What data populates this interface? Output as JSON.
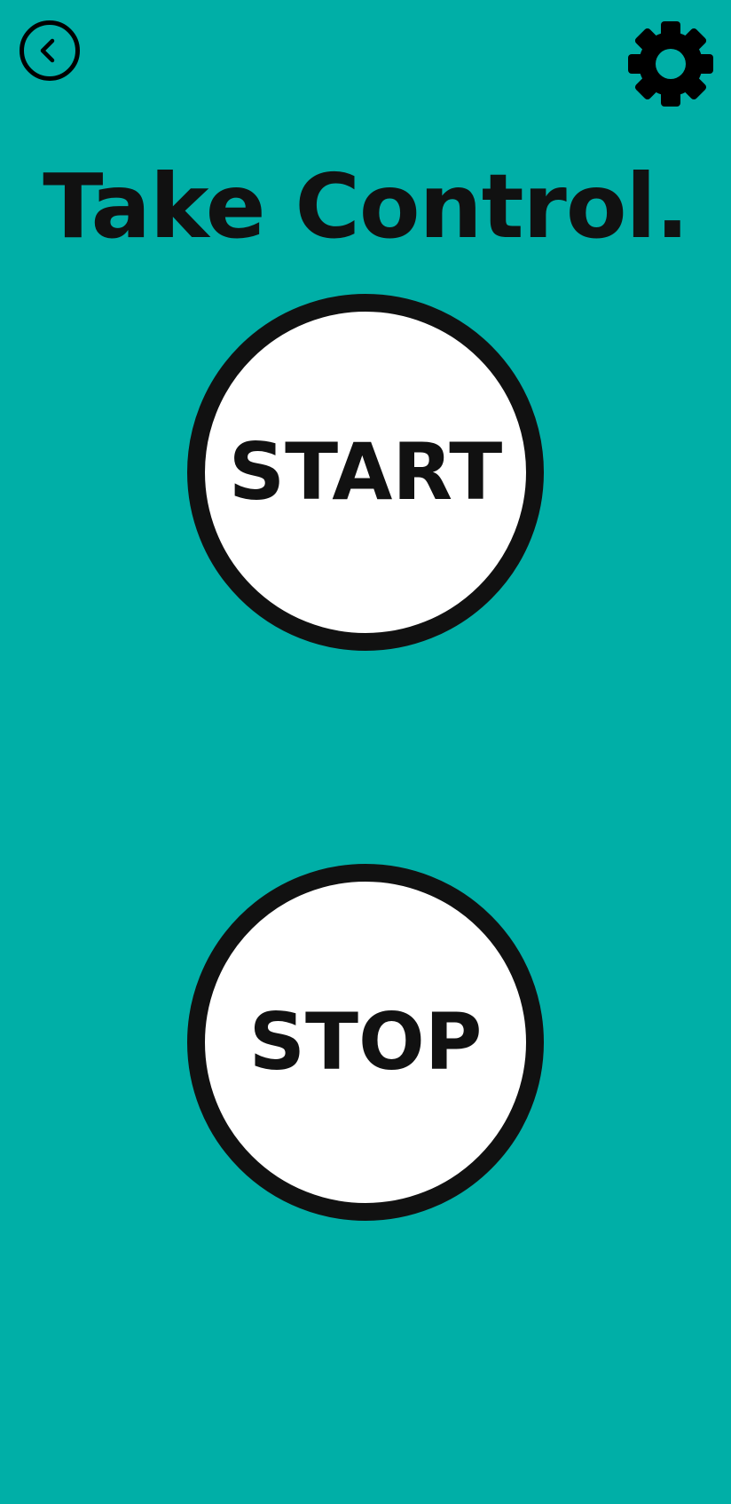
{
  "colors": {
    "background": "#00AFA7",
    "foreground": "#111111",
    "button_fill": "#FFFFFF"
  },
  "header": {
    "back_icon": "chevron-left-circle-icon",
    "settings_icon": "gear-icon"
  },
  "main": {
    "title": "Take Control.",
    "start_label": "START",
    "stop_label": "STOP"
  }
}
